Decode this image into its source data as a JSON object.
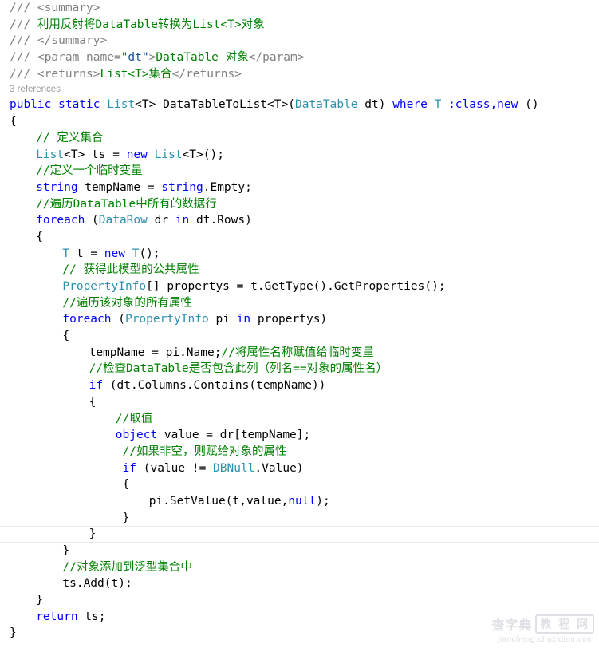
{
  "editor": {
    "language": "csharp",
    "background_color": "#ffffff",
    "colors": {
      "keyword": "#0000ff",
      "type": "#2b91af",
      "comment": "#008000",
      "xml_doc_tag": "#808080",
      "xml_attr_value": "#1b4f9c",
      "plain_text": "#000000",
      "codelens": "#9a9a9a",
      "current_line_border": "#e9e9f2"
    },
    "codelens": {
      "label": "3 references"
    },
    "lines": [
      {
        "id": 1,
        "indent": 0,
        "tokens": [
          {
            "t": "/// ",
            "c": "xtag"
          },
          {
            "t": "<summary>",
            "c": "xtag"
          }
        ]
      },
      {
        "id": 2,
        "indent": 0,
        "tokens": [
          {
            "t": "/// ",
            "c": "xtag"
          },
          {
            "t": "利用反射将DataTable转换为List<T>对象",
            "c": "xcmt"
          }
        ]
      },
      {
        "id": 3,
        "indent": 0,
        "tokens": [
          {
            "t": "/// ",
            "c": "xtag"
          },
          {
            "t": "</summary>",
            "c": "xtag"
          }
        ]
      },
      {
        "id": 4,
        "indent": 0,
        "tokens": [
          {
            "t": "/// ",
            "c": "xtag"
          },
          {
            "t": "<param name=",
            "c": "xtag"
          },
          {
            "t": "\"dt\"",
            "c": "xval"
          },
          {
            "t": ">",
            "c": "xtag"
          },
          {
            "t": "DataTable 对象",
            "c": "xcmt"
          },
          {
            "t": "</param>",
            "c": "xtag"
          }
        ]
      },
      {
        "id": 5,
        "indent": 0,
        "tokens": [
          {
            "t": "/// ",
            "c": "xtag"
          },
          {
            "t": "<returns>",
            "c": "xtag"
          },
          {
            "t": "List<T>集合",
            "c": "xcmt"
          },
          {
            "t": "</returns>",
            "c": "xtag"
          }
        ]
      },
      {
        "id": 6,
        "codelens": true,
        "text": "3 references"
      },
      {
        "id": 7,
        "indent": 0,
        "tokens": [
          {
            "t": "public",
            "c": "kw"
          },
          {
            "t": " ",
            "c": "pln"
          },
          {
            "t": "static",
            "c": "kw"
          },
          {
            "t": " ",
            "c": "pln"
          },
          {
            "t": "List",
            "c": "typ"
          },
          {
            "t": "<T> DataTableToList<T>(",
            "c": "pln"
          },
          {
            "t": "DataTable",
            "c": "typ"
          },
          {
            "t": " dt) ",
            "c": "pln"
          },
          {
            "t": "where",
            "c": "kw"
          },
          {
            "t": " ",
            "c": "pln"
          },
          {
            "t": "T",
            "c": "typ"
          },
          {
            "t": " ",
            "c": "pln"
          },
          {
            "t": ":class,new",
            "c": "kw"
          },
          {
            "t": " ()",
            "c": "pln"
          }
        ]
      },
      {
        "id": 8,
        "indent": 0,
        "tokens": [
          {
            "t": "{",
            "c": "pln"
          }
        ]
      },
      {
        "id": 9,
        "indent": 1,
        "tokens": [
          {
            "t": "// 定义集合",
            "c": "cmt"
          }
        ]
      },
      {
        "id": 10,
        "indent": 1,
        "tokens": [
          {
            "t": "List",
            "c": "typ"
          },
          {
            "t": "<T> ts = ",
            "c": "pln"
          },
          {
            "t": "new",
            "c": "kw"
          },
          {
            "t": " ",
            "c": "pln"
          },
          {
            "t": "List",
            "c": "typ"
          },
          {
            "t": "<T>();",
            "c": "pln"
          }
        ]
      },
      {
        "id": 11,
        "indent": 1,
        "tokens": [
          {
            "t": "//定义一个临时变量",
            "c": "cmt"
          }
        ]
      },
      {
        "id": 12,
        "indent": 1,
        "tokens": [
          {
            "t": "string",
            "c": "kw"
          },
          {
            "t": " tempName = ",
            "c": "pln"
          },
          {
            "t": "string",
            "c": "kw"
          },
          {
            "t": ".Empty;",
            "c": "pln"
          }
        ]
      },
      {
        "id": 13,
        "indent": 1,
        "tokens": [
          {
            "t": "//遍历DataTable中所有的数据行",
            "c": "cmt"
          }
        ]
      },
      {
        "id": 14,
        "indent": 1,
        "tokens": [
          {
            "t": "foreach",
            "c": "kw"
          },
          {
            "t": " (",
            "c": "pln"
          },
          {
            "t": "DataRow",
            "c": "typ"
          },
          {
            "t": " dr ",
            "c": "pln"
          },
          {
            "t": "in",
            "c": "kw"
          },
          {
            "t": " dt.Rows)",
            "c": "pln"
          }
        ]
      },
      {
        "id": 15,
        "indent": 1,
        "tokens": [
          {
            "t": "{",
            "c": "pln"
          }
        ]
      },
      {
        "id": 16,
        "indent": 2,
        "tokens": [
          {
            "t": "T",
            "c": "typ"
          },
          {
            "t": " t = ",
            "c": "pln"
          },
          {
            "t": "new",
            "c": "kw"
          },
          {
            "t": " ",
            "c": "pln"
          },
          {
            "t": "T",
            "c": "typ"
          },
          {
            "t": "();",
            "c": "pln"
          }
        ]
      },
      {
        "id": 17,
        "indent": 2,
        "tokens": [
          {
            "t": "// 获得此模型的公共属性",
            "c": "cmt"
          }
        ]
      },
      {
        "id": 18,
        "indent": 2,
        "tokens": [
          {
            "t": "PropertyInfo",
            "c": "typ"
          },
          {
            "t": "[] propertys = t.GetType().GetProperties();",
            "c": "pln"
          }
        ]
      },
      {
        "id": 19,
        "indent": 2,
        "tokens": [
          {
            "t": "//遍历该对象的所有属性",
            "c": "cmt"
          }
        ]
      },
      {
        "id": 20,
        "indent": 2,
        "tokens": [
          {
            "t": "foreach",
            "c": "kw"
          },
          {
            "t": " (",
            "c": "pln"
          },
          {
            "t": "PropertyInfo",
            "c": "typ"
          },
          {
            "t": " pi ",
            "c": "pln"
          },
          {
            "t": "in",
            "c": "kw"
          },
          {
            "t": " propertys)",
            "c": "pln"
          }
        ]
      },
      {
        "id": 21,
        "indent": 2,
        "tokens": [
          {
            "t": "{",
            "c": "pln"
          }
        ]
      },
      {
        "id": 22,
        "indent": 3,
        "tokens": [
          {
            "t": "tempName = pi.Name;",
            "c": "pln"
          },
          {
            "t": "//将属性名称赋值给临时变量",
            "c": "cmt"
          }
        ]
      },
      {
        "id": 23,
        "indent": 3,
        "tokens": [
          {
            "t": "//检查DataTable是否包含此列（列名==对象的属性名）",
            "c": "cmt"
          }
        ]
      },
      {
        "id": 24,
        "indent": 3,
        "tokens": [
          {
            "t": "if",
            "c": "kw"
          },
          {
            "t": " (dt.Columns.Contains(tempName))",
            "c": "pln"
          }
        ]
      },
      {
        "id": 25,
        "indent": 3,
        "tokens": [
          {
            "t": "{",
            "c": "pln"
          }
        ]
      },
      {
        "id": 26,
        "indent": 4,
        "tokens": [
          {
            "t": "//取值",
            "c": "cmt"
          }
        ]
      },
      {
        "id": 27,
        "indent": 4,
        "tokens": [
          {
            "t": "object",
            "c": "kw"
          },
          {
            "t": " value = dr[tempName];",
            "c": "pln"
          }
        ]
      },
      {
        "id": 28,
        "indent": 4,
        "tokens": [
          {
            "t": " //如果非空，则赋给对象的属性",
            "c": "cmt"
          }
        ]
      },
      {
        "id": 29,
        "indent": 4,
        "tokens": [
          {
            "t": " ",
            "c": "pln"
          },
          {
            "t": "if",
            "c": "kw"
          },
          {
            "t": " (value != ",
            "c": "pln"
          },
          {
            "t": "DBNull",
            "c": "typ"
          },
          {
            "t": ".Value)",
            "c": "pln"
          }
        ]
      },
      {
        "id": 30,
        "indent": 4,
        "tokens": [
          {
            "t": " {",
            "c": "pln"
          }
        ]
      },
      {
        "id": 31,
        "indent": 5,
        "tokens": [
          {
            "t": " pi.SetValue(t,value,",
            "c": "pln"
          },
          {
            "t": "null",
            "c": "kw"
          },
          {
            "t": ");",
            "c": "pln"
          }
        ]
      },
      {
        "id": 32,
        "indent": 4,
        "tokens": [
          {
            "t": " }",
            "c": "pln"
          }
        ]
      },
      {
        "id": 33,
        "indent": 3,
        "current": true,
        "tokens": [
          {
            "t": "}",
            "c": "pln"
          }
        ]
      },
      {
        "id": 34,
        "indent": 2,
        "tokens": [
          {
            "t": "}",
            "c": "pln"
          }
        ]
      },
      {
        "id": 35,
        "indent": 2,
        "tokens": [
          {
            "t": "//对象添加到泛型集合中",
            "c": "cmt"
          }
        ]
      },
      {
        "id": 36,
        "indent": 2,
        "tokens": [
          {
            "t": "ts.Add(t);",
            "c": "pln"
          }
        ]
      },
      {
        "id": 37,
        "indent": 1,
        "tokens": [
          {
            "t": "}",
            "c": "pln"
          }
        ]
      },
      {
        "id": 38,
        "indent": 1,
        "tokens": [
          {
            "t": "return",
            "c": "kw"
          },
          {
            "t": " ts;",
            "c": "pln"
          }
        ]
      },
      {
        "id": 39,
        "indent": 0,
        "tokens": [
          {
            "t": "}",
            "c": "pln"
          }
        ]
      }
    ]
  },
  "watermark": {
    "brand": "查字典",
    "badge": "教 程 网",
    "url": "jiaocheng.chazidian.com"
  }
}
